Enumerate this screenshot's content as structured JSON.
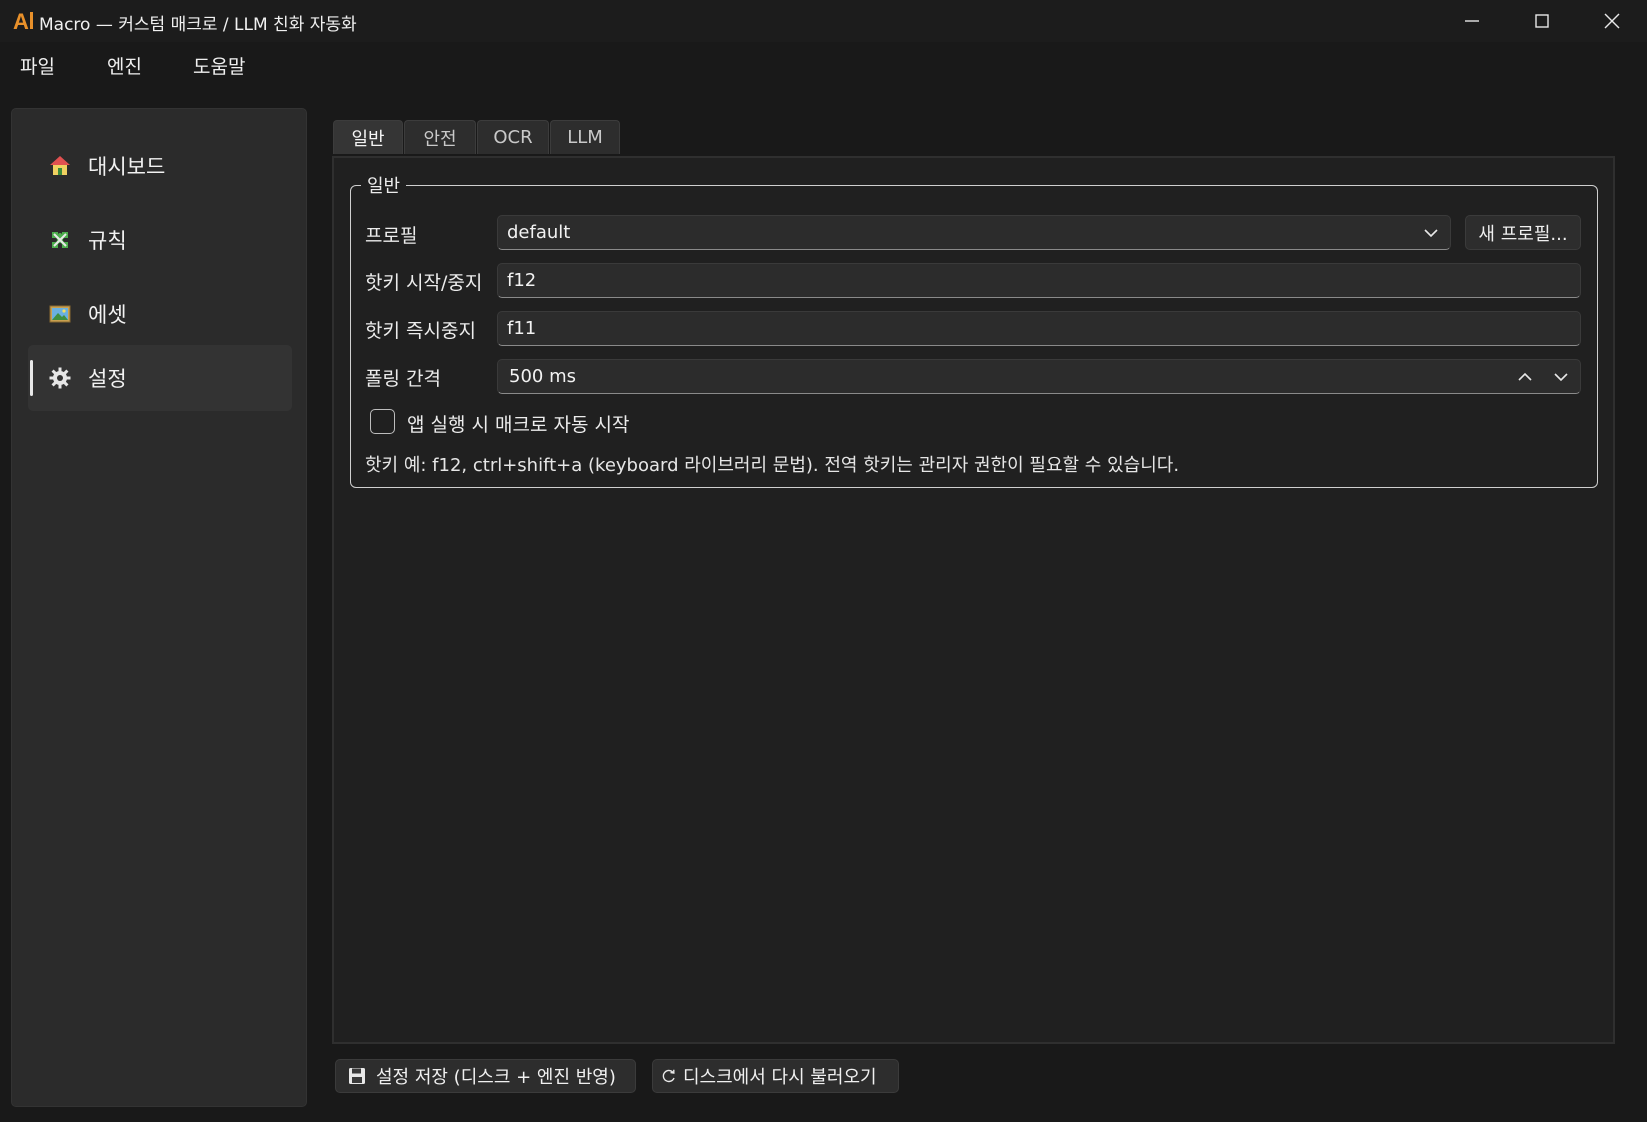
{
  "window": {
    "title": "Macro — 커스텀 매크로 / LLM 친화 자동화",
    "icons": {
      "app": "ai-logo-icon",
      "minimize": "minimize-icon",
      "maximize": "maximize-icon",
      "close": "close-icon"
    }
  },
  "menu": [
    "파일",
    "엔진",
    "도움말"
  ],
  "sidebar": {
    "items": [
      {
        "label": "대시보드",
        "icon": "home-icon"
      },
      {
        "label": "규칙",
        "icon": "puzzle-icon"
      },
      {
        "label": "에셋",
        "icon": "image-icon"
      },
      {
        "label": "설정",
        "icon": "gear-icon",
        "active": true
      }
    ]
  },
  "tabs": [
    {
      "label": "일반",
      "active": true
    },
    {
      "label": "안전"
    },
    {
      "label": "OCR"
    },
    {
      "label": "LLM"
    }
  ],
  "general": {
    "group_title": "일반",
    "profile_label": "프로필",
    "profile_value": "default",
    "new_profile_button": "새 프로필...",
    "hotkey_start_label": "핫키 시작/중지",
    "hotkey_start_value": "f12",
    "hotkey_stop_label": "핫키 즉시중지",
    "hotkey_stop_value": "f11",
    "polling_label": "폴링 간격",
    "polling_value": "500 ms",
    "autostart_label": "앱 실행 시 매크로 자동 시작",
    "autostart_checked": false,
    "hint": "핫키 예: f12, ctrl+shift+a (keyboard 라이브러리 문법). 전역 핫키는 관리자 권한이 필요할 수 있습니다."
  },
  "footer": {
    "save_button": "설정 저장 (디스크 + 엔진 반영)",
    "save_icon": "floppy-disk-icon",
    "reload_button": "디스크에서 다시 불러오기",
    "reload_icon": "refresh-icon"
  },
  "colors": {
    "background": "#191919",
    "panel": "#202020",
    "sidebar": "#2b2b2b",
    "accent_logo": "#e8902a"
  }
}
